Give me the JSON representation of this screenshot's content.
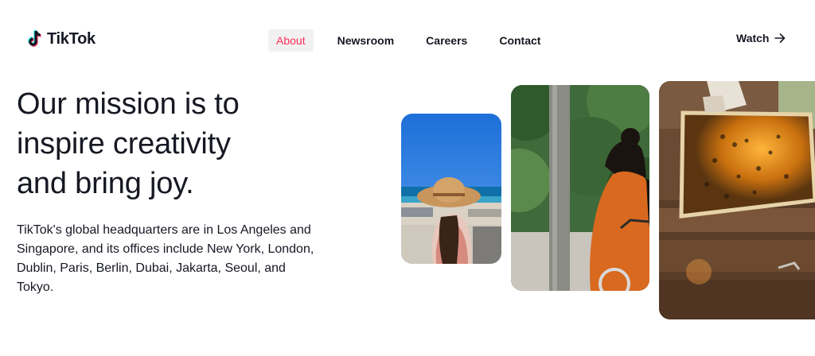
{
  "brand": {
    "name": "TikTok",
    "icon": "tiktok-note-icon",
    "accent": "#fe2c55",
    "cyan": "#25f4ee"
  },
  "nav": {
    "items": [
      {
        "label": "About",
        "active": true
      },
      {
        "label": "Newsroom",
        "active": false
      },
      {
        "label": "Careers",
        "active": false
      },
      {
        "label": "Contact",
        "active": false
      }
    ]
  },
  "watch": {
    "label": "Watch",
    "icon": "arrow-right-icon"
  },
  "hero": {
    "headline_lines": [
      "Our mission is to",
      "inspire creativity",
      "and bring joy."
    ],
    "description": "TikTok's global headquarters are in Los Angeles and Singapore, and its offices include New York, London, Dublin, Paris, Berlin, Dubai, Jakarta, Seoul, and Tokyo."
  },
  "gallery": {
    "images": [
      {
        "name": "woman-in-sun-hat-at-beach"
      },
      {
        "name": "woman-cycling-by-trees"
      },
      {
        "name": "beekeeper-honeycomb-frame"
      }
    ]
  }
}
